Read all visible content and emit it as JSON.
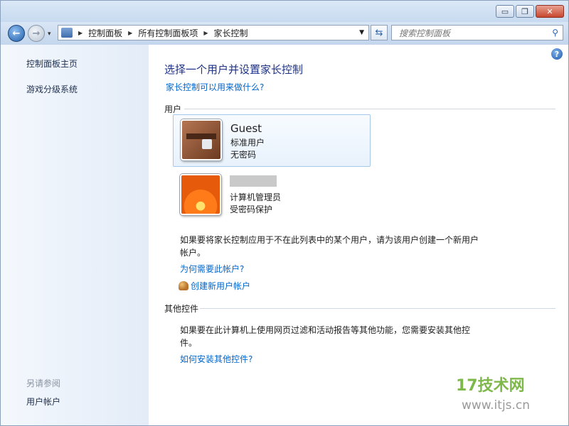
{
  "window": {
    "minimize_glyph": "▭",
    "restore_glyph": "❐",
    "close_glyph": "✕"
  },
  "nav": {
    "back_glyph": "←",
    "forward_glyph": "→",
    "breadcrumbs": [
      "控制面板",
      "所有控制面板项",
      "家长控制"
    ],
    "search_placeholder": "搜索控制面板"
  },
  "sidebar": {
    "links": [
      "控制面板主页",
      "游戏分级系统"
    ],
    "see_also_heading": "另请参阅",
    "see_also_links": [
      "用户帐户"
    ]
  },
  "main": {
    "title": "选择一个用户并设置家长控制",
    "what_can_do_link": "家长控制可以用来做什么?",
    "users_heading": "用户",
    "users": [
      {
        "name": "Guest",
        "type": "标准用户",
        "password": "无密码",
        "selected": true,
        "avatar": "briefcase-avatar"
      },
      {
        "name": "",
        "type": "计算机管理员",
        "password": "受密码保护",
        "selected": false,
        "avatar": "flower-avatar"
      }
    ],
    "create_user_para": "如果要将家长控制应用于不在此列表中的某个用户，请为该用户创建一个新用户帐户。",
    "why_account_link": "为何需要此帐户?",
    "create_account_link": "创建新用户帐户",
    "other_controls_heading": "其他控件",
    "other_controls_para": "如果要在此计算机上使用网页过滤和活动报告等其他功能，您需要安装其他控件。",
    "install_link": "如何安装其他控件?"
  },
  "watermark": {
    "logo_text": "17技术网",
    "url_text": "www.itjs.cn"
  },
  "colors": {
    "title_blue": "#1e3287",
    "link_blue": "#0066cc",
    "selection_border": "#a4c7ea"
  }
}
